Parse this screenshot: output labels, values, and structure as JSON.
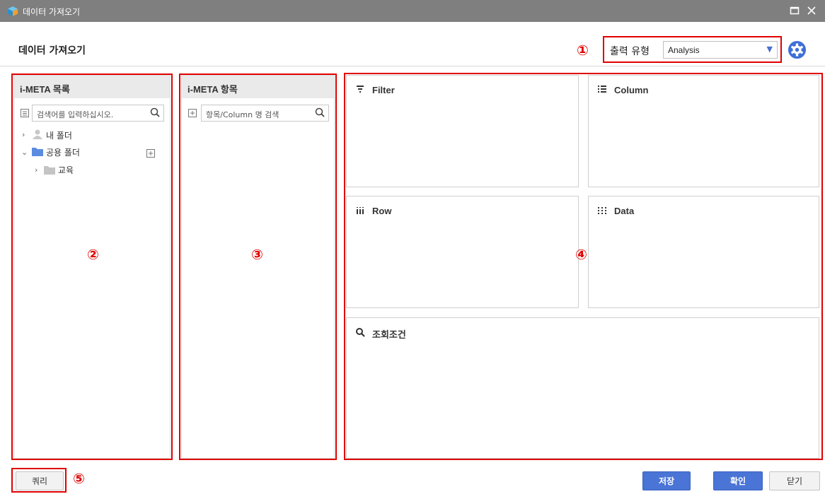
{
  "window": {
    "title": "데이터 가져오기",
    "maximize_icon": "maximize-icon",
    "close_icon": "close-icon"
  },
  "header": {
    "title": "데이터 가져오기"
  },
  "output": {
    "label": "출력 유형",
    "selected": "Analysis"
  },
  "markers": {
    "m1": "①",
    "m2": "②",
    "m3": "③",
    "m4": "④",
    "m5": "⑤"
  },
  "meta_list": {
    "title": "i-META 목록",
    "search_placeholder": "검색어를 입력하십시오.",
    "tree": [
      {
        "label": "내 폴더"
      },
      {
        "label": "공용 폴더"
      },
      {
        "label": "교육"
      }
    ]
  },
  "meta_items": {
    "title": "i-META 항목",
    "search_placeholder": "항목/Column 명 검색"
  },
  "zones": {
    "filter": "Filter",
    "column": "Column",
    "row": "Row",
    "data": "Data",
    "condition": "조회조건"
  },
  "footer": {
    "query": "쿼리",
    "save": "저장",
    "confirm": "확인",
    "close": "닫기"
  },
  "colors": {
    "accent": "#4a74d6",
    "highlight": "#e00000",
    "titlebar": "#7f7f7f"
  }
}
